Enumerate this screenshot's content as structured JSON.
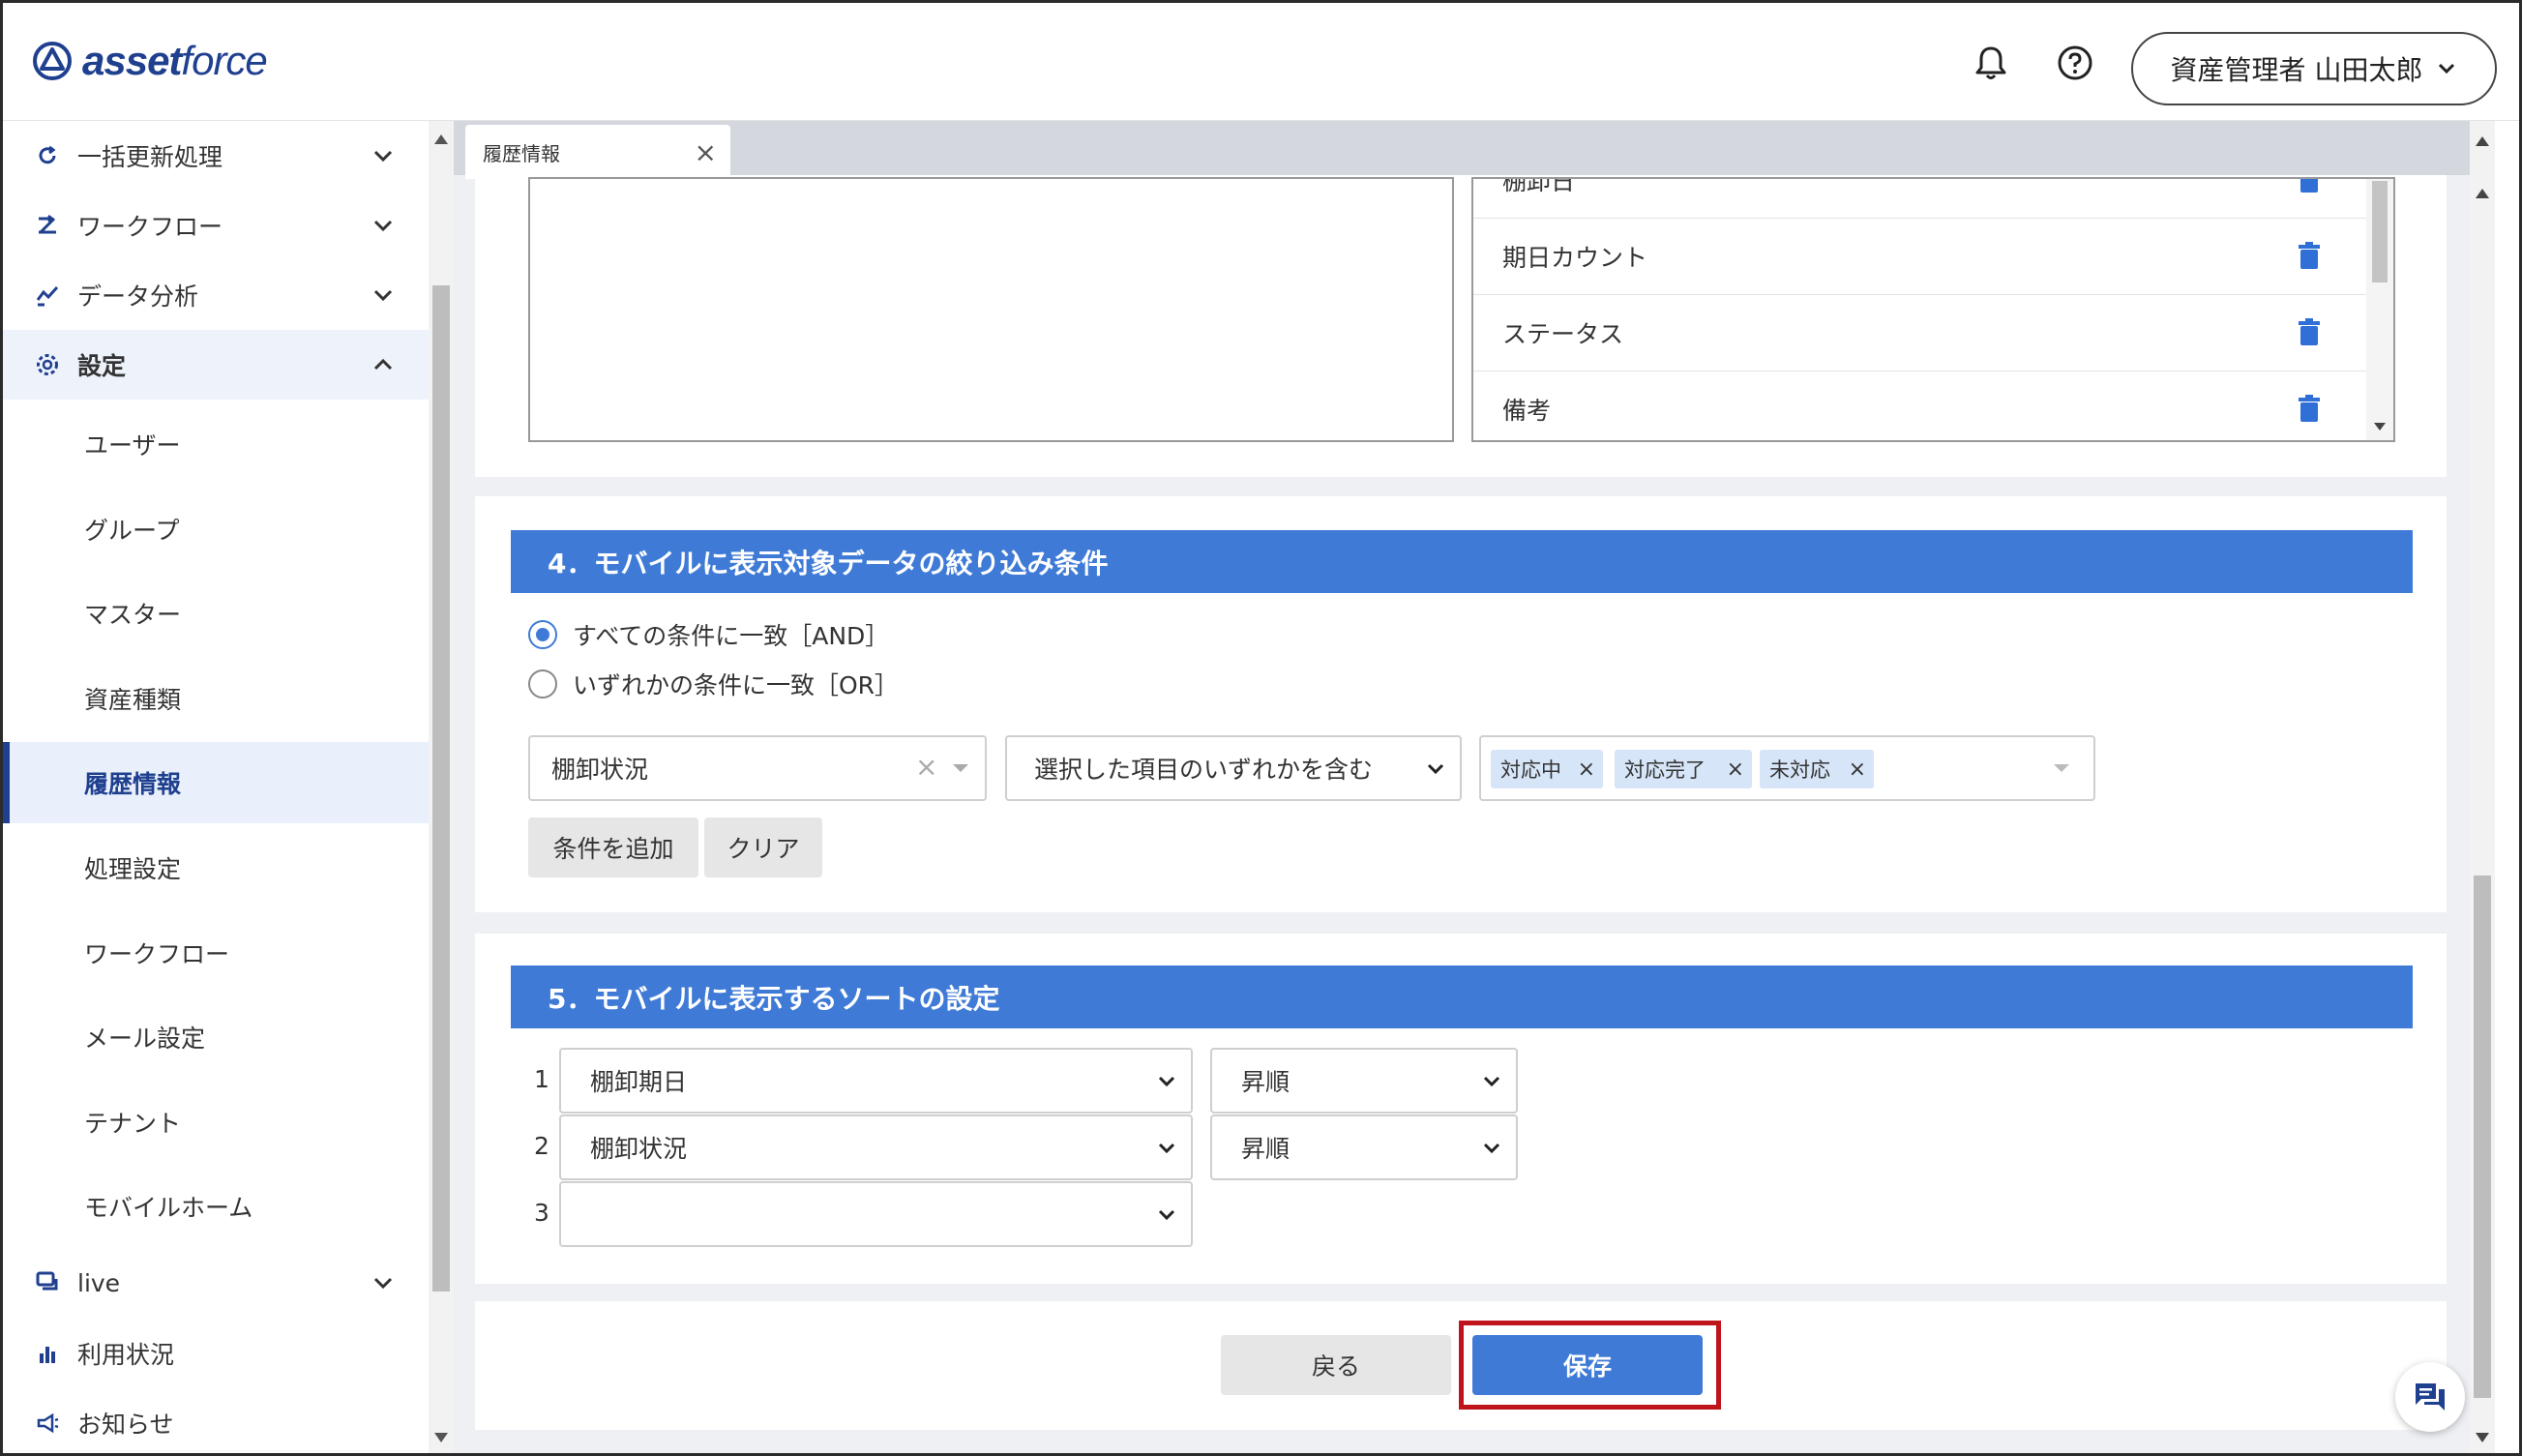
{
  "header": {
    "logo_bold": "asset",
    "logo_light": "force",
    "user_label": "資産管理者 山田太郎"
  },
  "sidebar": {
    "groups": [
      {
        "label": "一括更新処理"
      },
      {
        "label": "ワークフロー"
      },
      {
        "label": "データ分析"
      },
      {
        "label": "設定"
      }
    ],
    "settings_items": [
      {
        "label": "ユーザー"
      },
      {
        "label": "グループ"
      },
      {
        "label": "マスター"
      },
      {
        "label": "資産種類"
      },
      {
        "label": "履歴情報"
      },
      {
        "label": "処理設定"
      },
      {
        "label": "ワークフロー"
      },
      {
        "label": "メール設定"
      },
      {
        "label": "テナント"
      },
      {
        "label": "モバイルホーム"
      }
    ],
    "bottom": [
      {
        "label": "live"
      },
      {
        "label": "利用状況"
      },
      {
        "label": "お知らせ"
      }
    ],
    "active_item": "履歴情報"
  },
  "tabs": [
    {
      "label": "履歴情報"
    }
  ],
  "selected_fields": [
    {
      "label": "棚卸日"
    },
    {
      "label": "期日カウント"
    },
    {
      "label": "ステータス"
    },
    {
      "label": "備考"
    }
  ],
  "section4": {
    "title": "4．モバイルに表示対象データの絞り込み条件",
    "radio_and": "すべての条件に一致［AND］",
    "radio_or": "いずれかの条件に一致［OR］",
    "selected_mode": "AND",
    "field": "棚卸状況",
    "operator": "選択した項目のいずれかを含む",
    "values": [
      "対応中",
      "対応完了",
      "未対応"
    ],
    "add_button": "条件を追加",
    "clear_button": "クリア"
  },
  "section5": {
    "title": "5．モバイルに表示するソートの設定",
    "rows": [
      {
        "num": "1",
        "field": "棚卸期日",
        "order": "昇順"
      },
      {
        "num": "2",
        "field": "棚卸状況",
        "order": "昇順"
      },
      {
        "num": "3",
        "field": "",
        "order": ""
      }
    ]
  },
  "footer": {
    "back_label": "戻る",
    "save_label": "保存"
  },
  "colors": {
    "accent": "#3f7bd6",
    "brand": "#1f3f8f",
    "highlight": "#c0141c"
  }
}
